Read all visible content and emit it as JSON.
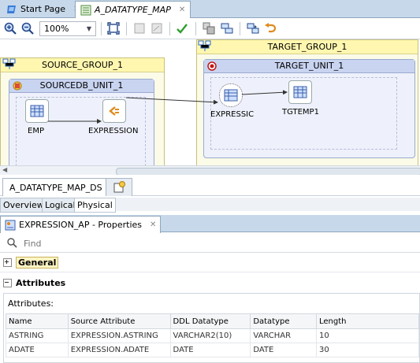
{
  "tabs": {
    "start_page": "Start Page",
    "mapping": "A_DATATYPE_MAP"
  },
  "toolbar": {
    "zoom_value": "100%"
  },
  "diagram": {
    "source_group": "SOURCE_GROUP_1",
    "source_unit": "SOURCEDB_UNIT_1",
    "node_emp": "EMP",
    "node_expression": "EXPRESSION",
    "target_group": "TARGET_GROUP_1",
    "target_unit": "TARGET_UNIT_1",
    "node_expression_target": "EXPRESSIC",
    "node_tgtemp": "TGTEMP1"
  },
  "diagram_tab": "A_DATATYPE_MAP_DS",
  "view_tabs": [
    "Overview",
    "Logical",
    "Physical"
  ],
  "properties": {
    "tab_title": "EXPRESSION_AP - Properties",
    "find_placeholder": "Find",
    "section_general": "General",
    "section_attributes": "Attributes",
    "attributes_label": "Attributes:",
    "columns": [
      "Name",
      "Source Attribute",
      "DDL Datatype",
      "Datatype",
      "Length"
    ],
    "rows": [
      [
        "ASTRING",
        "EXPRESSION.ASTRING",
        "VARCHAR2(10)",
        "VARCHAR",
        "10"
      ],
      [
        "ADATE",
        "EXPRESSION.ADATE",
        "DATE",
        "DATE",
        "30"
      ]
    ]
  },
  "colors": {
    "tab_bar": "#c6d8ea",
    "group_header": "#fff7b0",
    "unit_header": "#c9d4f0",
    "check": "#2e9e2e"
  }
}
